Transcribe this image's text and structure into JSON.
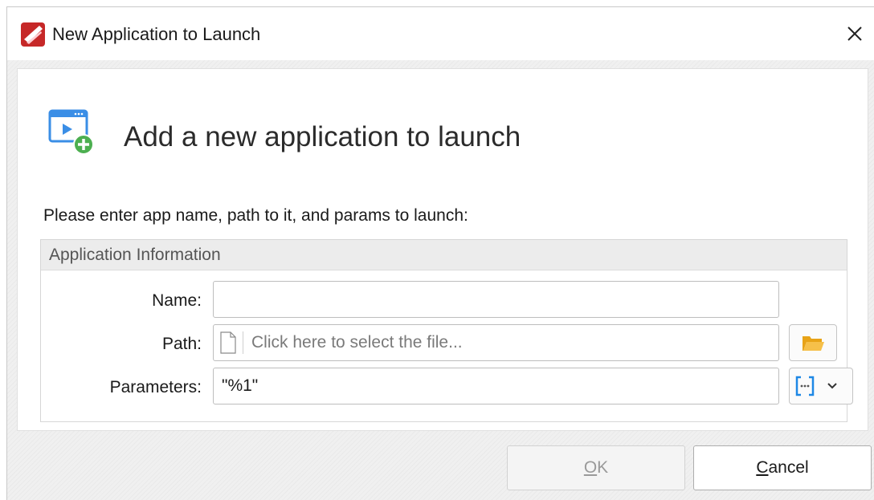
{
  "window": {
    "title": "New Application to Launch",
    "logo_icon": "pdf-xchange-logo",
    "close_icon": "close-icon"
  },
  "header": {
    "icon": "add-application-icon",
    "title": "Add a new application to launch"
  },
  "instructions": "Please enter app name, path to it, and params to launch:",
  "group": {
    "title": "Application Information",
    "name_label": "Name:",
    "name_value": "",
    "path_label": "Path:",
    "path_placeholder": "Click here to select the file...",
    "path_file_icon": "file-icon",
    "browse_icon": "folder-open-icon",
    "params_label": "Parameters:",
    "params_value": "\"%1\"",
    "macro_icon": "macro-insert-icon",
    "macro_dropdown_icon": "chevron-down-icon"
  },
  "buttons": {
    "ok_mnemonic": "O",
    "ok_rest": "K",
    "ok_enabled": false,
    "cancel_mnemonic": "C",
    "cancel_rest": "ancel"
  },
  "colors": {
    "folder": "#f0b323",
    "macro_bracket": "#1e88e5",
    "add_badge": "#4caf50",
    "logo_red": "#c62828"
  }
}
